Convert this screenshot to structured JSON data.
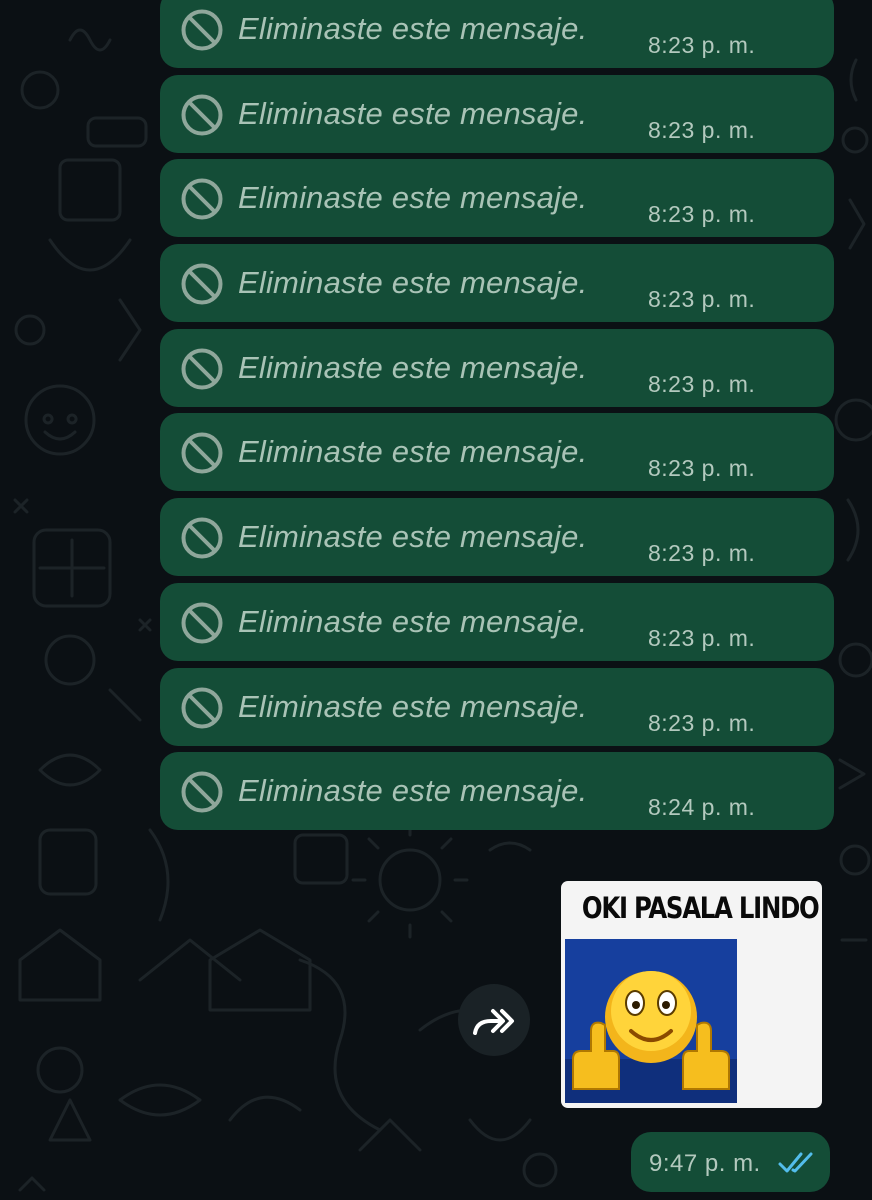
{
  "chat": {
    "deleted_messages": [
      {
        "text": "Eliminaste este mensaje.",
        "time": "8:23 p. m."
      },
      {
        "text": "Eliminaste este mensaje.",
        "time": "8:23 p. m."
      },
      {
        "text": "Eliminaste este mensaje.",
        "time": "8:23 p. m."
      },
      {
        "text": "Eliminaste este mensaje.",
        "time": "8:23 p. m."
      },
      {
        "text": "Eliminaste este mensaje.",
        "time": "8:23 p. m."
      },
      {
        "text": "Eliminaste este mensaje.",
        "time": "8:23 p. m."
      },
      {
        "text": "Eliminaste este mensaje.",
        "time": "8:23 p. m."
      },
      {
        "text": "Eliminaste este mensaje.",
        "time": "8:23 p. m."
      },
      {
        "text": "Eliminaste este mensaje.",
        "time": "8:23 p. m."
      },
      {
        "text": "Eliminaste este mensaje.",
        "time": "8:24 p. m."
      }
    ],
    "sticker": {
      "caption": "OKI PASALA LINDO",
      "image_icon": "thumbs-up-smiley-icon"
    },
    "forward_icon": "forward-icon",
    "last_message": {
      "time": "9:47 p. m.",
      "status_icon": "double-check-read-icon"
    }
  },
  "colors": {
    "background": "#0b1014",
    "outgoing_bubble": "#144d37",
    "deleted_text": "#a9c3b6",
    "read_ticks": "#53bdeb"
  }
}
